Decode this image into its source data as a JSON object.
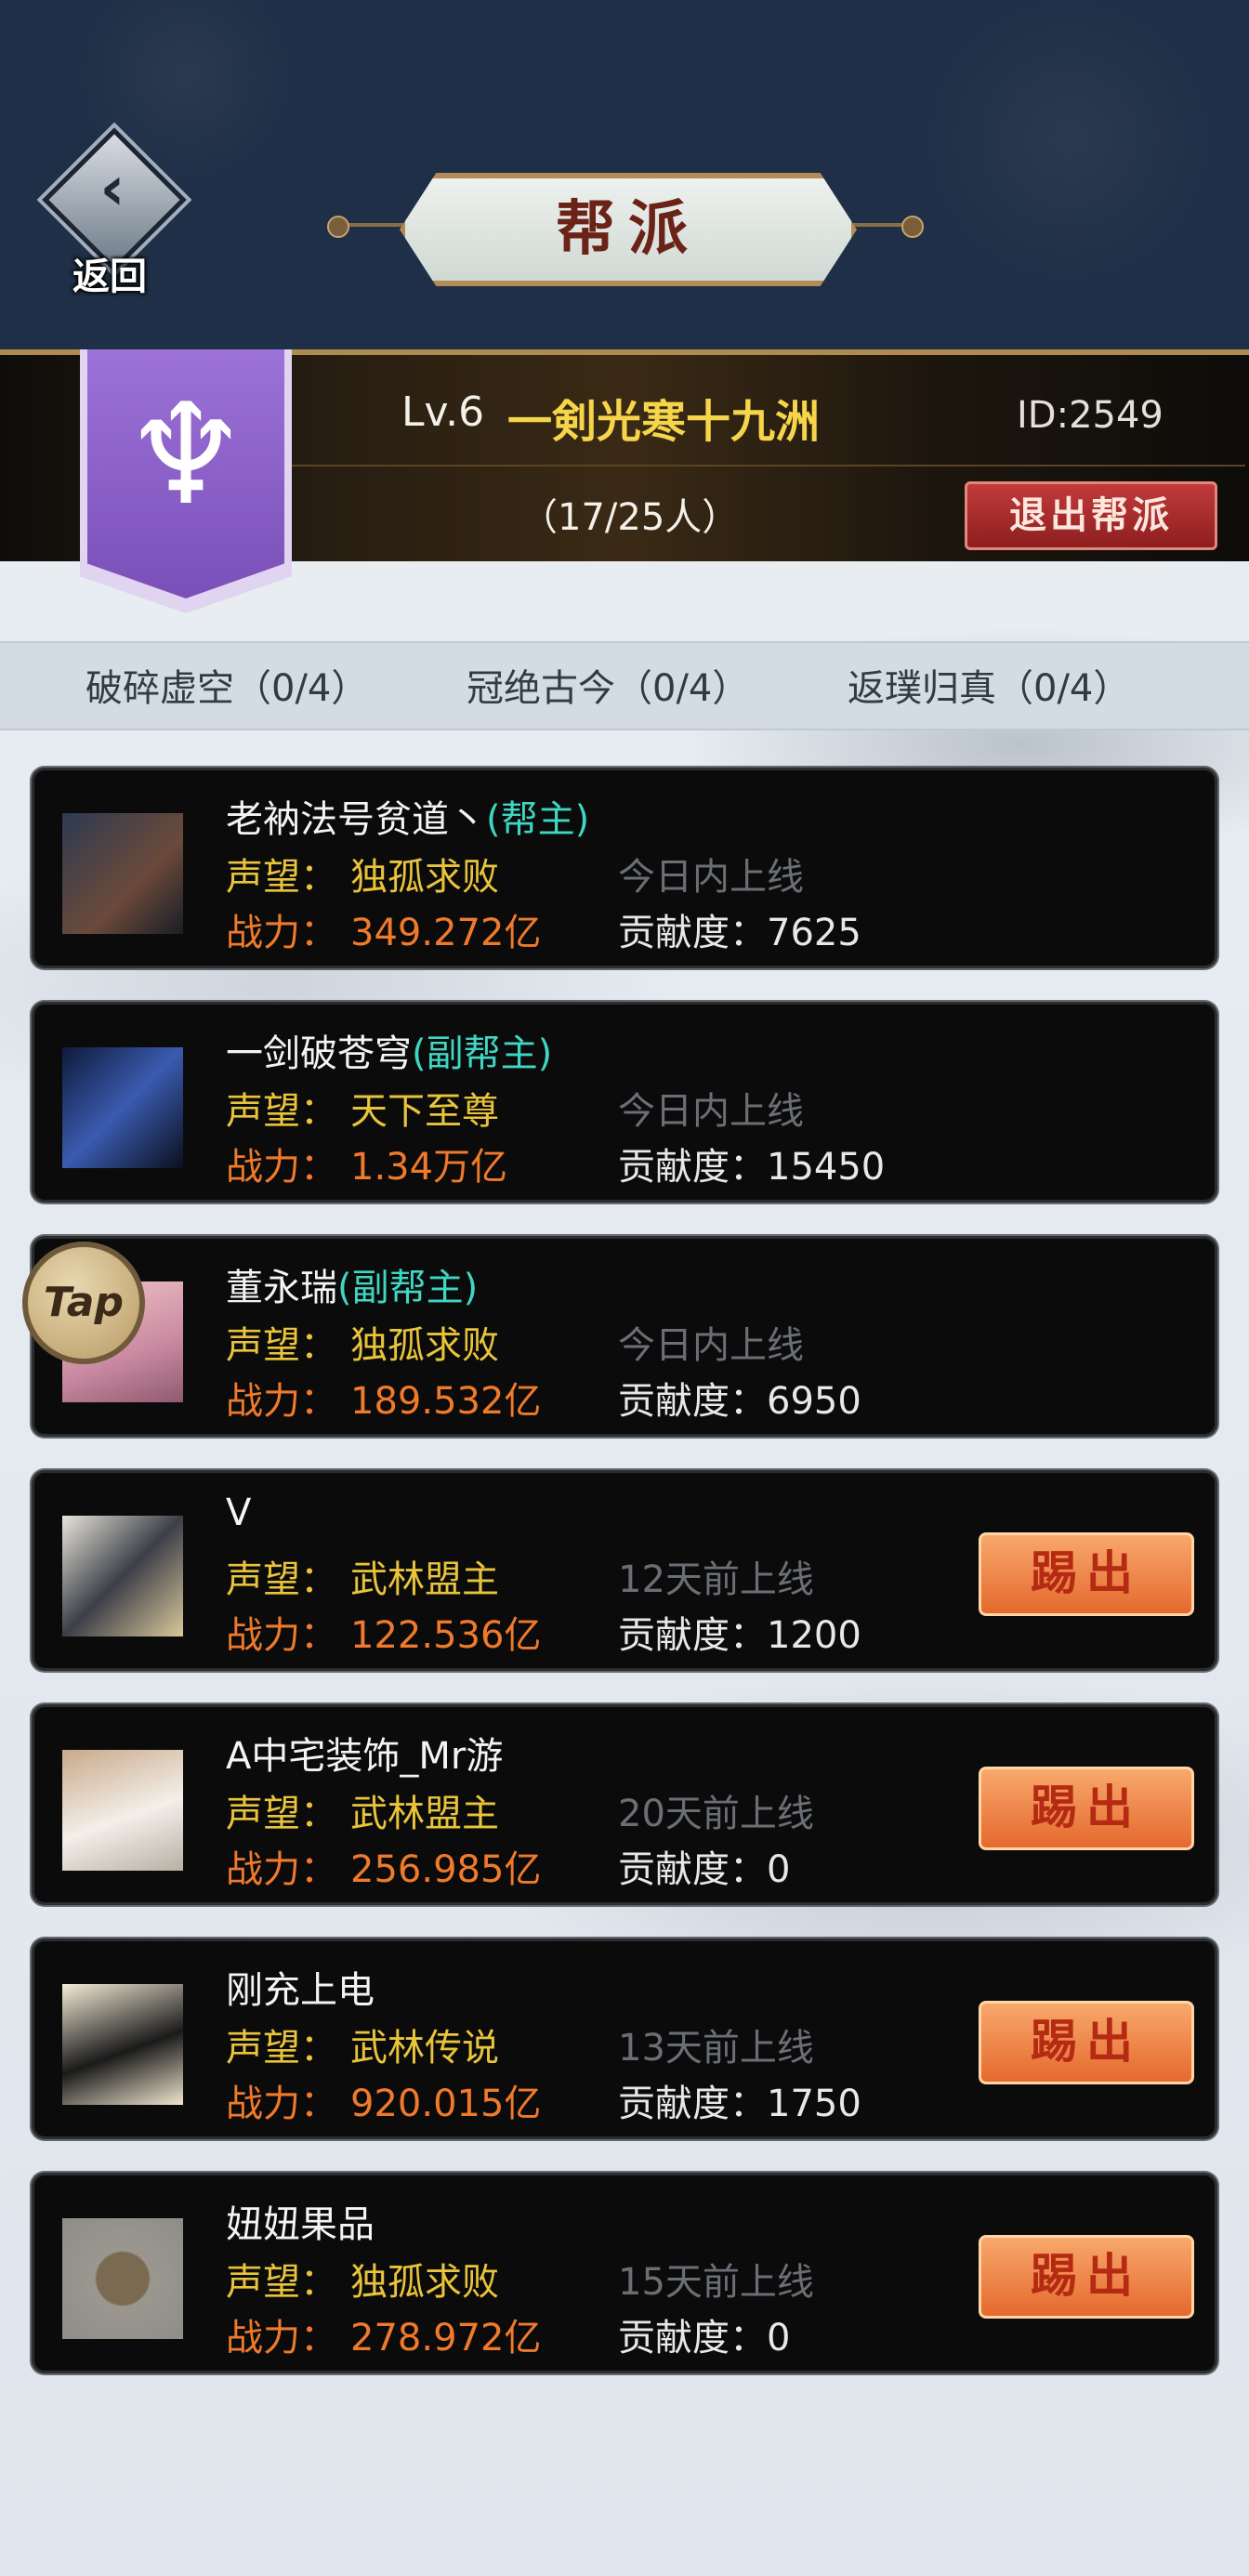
{
  "header": {
    "back_label": "返回",
    "title": "帮派"
  },
  "guild": {
    "level": "Lv.6",
    "name": "一剣光寒十九洲",
    "id": "ID:2549",
    "member_count": "（17/25人）",
    "quit_label": "退出帮派",
    "banner_color": "#8a5fc8"
  },
  "tiers": [
    {
      "label": "破碎虚空（0/4）"
    },
    {
      "label": "冠绝古今（0/4）"
    },
    {
      "label": "返璞归真（0/4）"
    }
  ],
  "labels": {
    "reputation": "声望：",
    "power": "战力：",
    "contribution": "贡献度："
  },
  "members": [
    {
      "name": "老衲法号贫道丶",
      "role": "(帮主)",
      "reputation": "独孤求败",
      "online": "今日内上线",
      "power": "349.272亿",
      "contribution": "7625"
    },
    {
      "name": "一剑破苍穹",
      "role": "(副帮主)",
      "reputation": "天下至尊",
      "online": "今日内上线",
      "power": "1.34万亿",
      "contribution": "15450"
    },
    {
      "name": "董永瑞",
      "role": "(副帮主)",
      "reputation": "独孤求败",
      "online": "今日内上线",
      "power": "189.532亿",
      "contribution": "6950"
    },
    {
      "name": "V",
      "role": "",
      "reputation": "武林盟主",
      "online": "12天前上线",
      "power": "122.536亿",
      "contribution": "1200",
      "kick_label": "踢出"
    },
    {
      "name": "A中宅装饰_Mr游",
      "role": "",
      "reputation": "武林盟主",
      "online": "20天前上线",
      "power": "256.985亿",
      "contribution": "0",
      "kick_label": "踢出"
    },
    {
      "name": "刚充上电",
      "role": "",
      "reputation": "武林传说",
      "online": "13天前上线",
      "power": "920.015亿",
      "contribution": "1750",
      "kick_label": "踢出"
    },
    {
      "name": "妞妞果品",
      "role": "",
      "reputation": "独孤求败",
      "online": "15天前上线",
      "power": "278.972亿",
      "contribution": "0",
      "kick_label": "踢出"
    }
  ],
  "tap_badge": "Tap"
}
